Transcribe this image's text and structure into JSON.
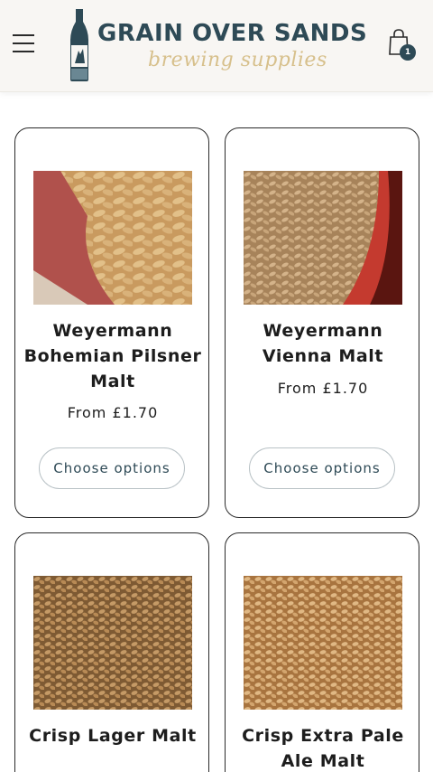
{
  "header": {
    "logo_title": "GRAIN OVER SANDS",
    "logo_subtitle": "brewing supplies",
    "cart_count": "1",
    "icons": [
      "hamburger-menu-icon",
      "bottle-logo-icon",
      "shopping-bag-icon"
    ]
  },
  "colors": {
    "brand": "#2e4a56",
    "accent": "#d7c08c",
    "card_border": "#2a2a2a",
    "header_bg": "#f8f6f3"
  },
  "products": [
    {
      "title": "Weyermann Bohemian Pilsner Malt",
      "price": "From £1.70",
      "button": "Choose options"
    },
    {
      "title": "Weyermann Vienna Malt",
      "price": "From £1.70",
      "button": "Choose options"
    },
    {
      "title": "Crisp Lager Malt",
      "price": "",
      "button": ""
    },
    {
      "title": "Crisp Extra Pale Ale Malt",
      "price": "",
      "button": ""
    }
  ]
}
